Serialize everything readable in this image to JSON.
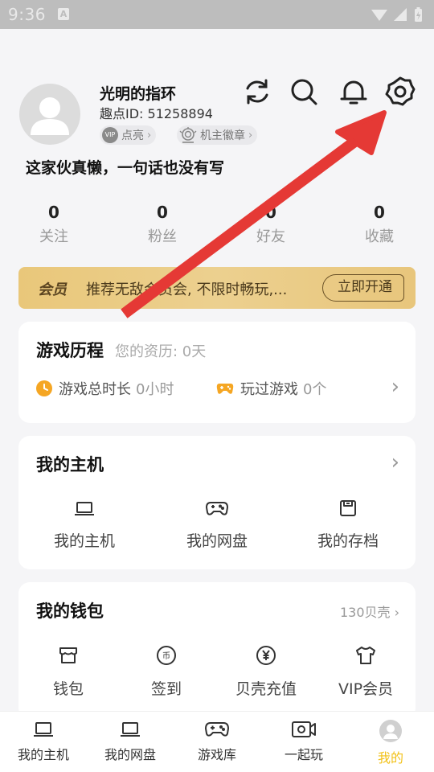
{
  "status_bar": {
    "time": "9:36",
    "badge": "A"
  },
  "profile": {
    "username": "光明的指环",
    "user_id": "趣点ID: 51258894",
    "chips": [
      {
        "badge": "VIP",
        "label": "点亮"
      },
      {
        "label": "机主徽章"
      }
    ],
    "bio": "这家伙真懒，一句话也没有写"
  },
  "top_icons": [
    "refresh-icon",
    "search-icon",
    "bell-icon",
    "gear-icon"
  ],
  "stats": [
    {
      "value": "0",
      "label": "关注"
    },
    {
      "value": "0",
      "label": "粉丝"
    },
    {
      "value": "0",
      "label": "好友"
    },
    {
      "value": "0",
      "label": "收藏"
    }
  ],
  "vip_banner": {
    "tag": "会员",
    "text": "推荐无敌会员会, 不限时畅玩,...",
    "button": "立即开通",
    "colors": {
      "start": "#e9c77a",
      "end": "#e8c67c"
    }
  },
  "game_history": {
    "title": "游戏历程",
    "subtitle": "您的资历: 0天",
    "total_time_label": "游戏总时长",
    "total_time_value": "0小时",
    "played_label": "玩过游戏",
    "played_value": "0个"
  },
  "my_host": {
    "title": "我的主机",
    "items": [
      {
        "label": "我的主机",
        "icon": "laptop-icon"
      },
      {
        "label": "我的网盘",
        "icon": "gamepad-icon"
      },
      {
        "label": "我的存档",
        "icon": "save-icon"
      }
    ]
  },
  "wallet": {
    "title": "我的钱包",
    "balance": "130贝壳",
    "items": [
      {
        "label": "钱包",
        "icon": "store-icon"
      },
      {
        "label": "签到",
        "icon": "coin-icon"
      },
      {
        "label": "贝壳充值",
        "icon": "yen-icon"
      },
      {
        "label": "VIP会员",
        "icon": "shirt-icon"
      }
    ]
  },
  "tabbar": {
    "tabs": [
      {
        "label": "我的主机",
        "icon": "laptop-icon"
      },
      {
        "label": "我的网盘",
        "icon": "laptop-icon"
      },
      {
        "label": "游戏库",
        "icon": "gamepad-icon"
      },
      {
        "label": "一起玩",
        "icon": "video-icon"
      },
      {
        "label": "我的",
        "icon": "avatar-icon"
      }
    ],
    "active_color": "#f2c21a"
  },
  "annotation": {
    "color": "#e53935"
  }
}
